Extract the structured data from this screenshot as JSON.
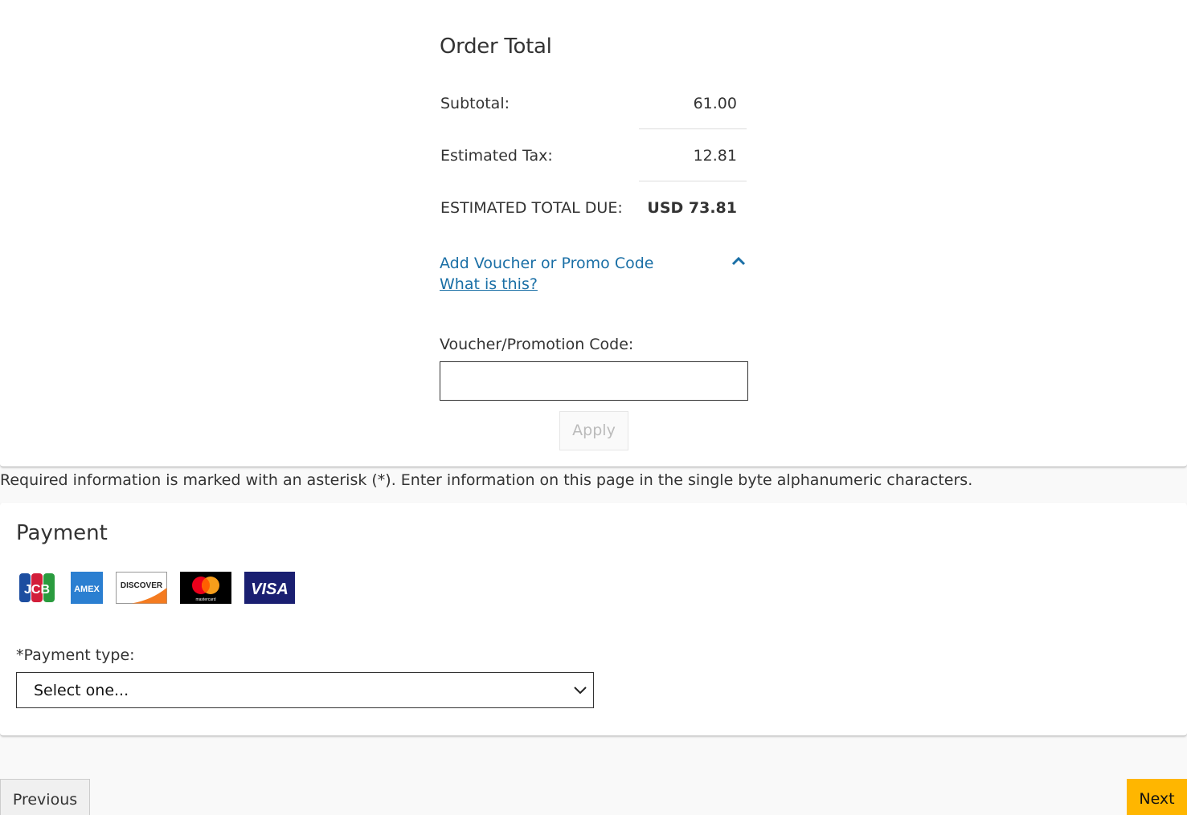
{
  "order_total": {
    "title": "Order Total",
    "subtotal_label": "Subtotal:",
    "subtotal_value": "61.00",
    "tax_label": "Estimated Tax:",
    "tax_value": "12.81",
    "total_label": "ESTIMATED TOTAL DUE:",
    "total_value": "USD 73.81"
  },
  "voucher": {
    "toggle_label": "Add Voucher or Promo Code",
    "toggle_icon": "chevron-up-icon",
    "help_link": "What is this?",
    "field_label": "Voucher/Promotion Code:",
    "field_value": "",
    "field_placeholder": "",
    "apply_label": "Apply"
  },
  "required_note": "Required information is marked with an asterisk (*). Enter information on this page in the single byte alphanumeric characters.",
  "payment": {
    "title": "Payment",
    "card_logos": [
      {
        "name": "JCB",
        "icon": "jcb-logo-icon"
      },
      {
        "name": "AMEX",
        "icon": "amex-logo-icon"
      },
      {
        "name": "DISCOVER",
        "icon": "discover-logo-icon"
      },
      {
        "name": "mastercard",
        "icon": "mastercard-logo-icon"
      },
      {
        "name": "VISA",
        "icon": "visa-logo-icon"
      }
    ],
    "type_label": "*Payment type:",
    "type_selected": "Select one..."
  },
  "nav": {
    "previous_label": "Previous",
    "next_label": "Next"
  },
  "colors": {
    "link": "#1a6fa6",
    "next_button": "#ffb600",
    "page_bg": "#f9f9f9"
  }
}
